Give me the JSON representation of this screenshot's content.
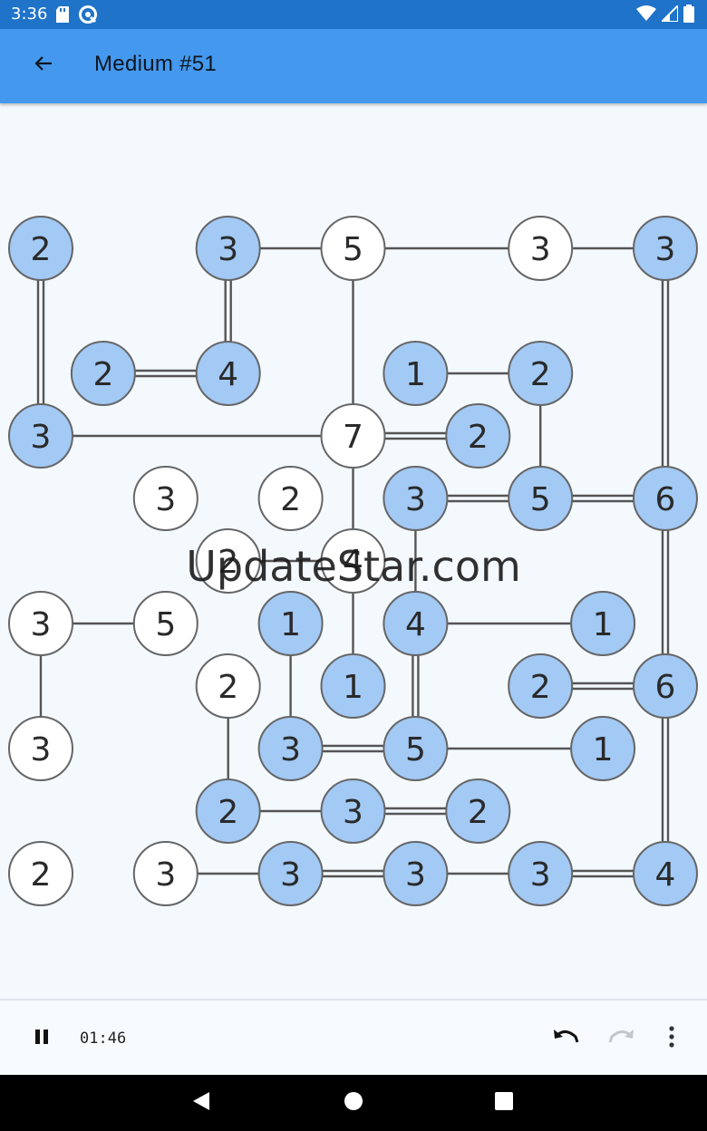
{
  "status_bar": {
    "time": "3:36",
    "icons": [
      "sd-card-icon",
      "sync-icon",
      "wifi-icon",
      "signal-icon",
      "battery-icon"
    ]
  },
  "app_bar": {
    "title": "Medium #51",
    "back_icon": "arrow-back-icon",
    "background": "#4499ee"
  },
  "puzzle": {
    "grid": {
      "cols": 11,
      "rows": 11
    },
    "colors": {
      "complete_fill": "#a3c9f5",
      "open_fill": "#ffffff",
      "node_stroke": "#666666",
      "bridge": "#555555"
    },
    "islands": [
      {
        "id": "a",
        "col": 0,
        "row": 0,
        "value": "2",
        "complete": true
      },
      {
        "id": "b",
        "col": 3,
        "row": 0,
        "value": "3",
        "complete": true
      },
      {
        "id": "c",
        "col": 5,
        "row": 0,
        "value": "5",
        "complete": false
      },
      {
        "id": "d",
        "col": 8,
        "row": 0,
        "value": "3",
        "complete": false
      },
      {
        "id": "e",
        "col": 10,
        "row": 0,
        "value": "3",
        "complete": true
      },
      {
        "id": "f",
        "col": 1,
        "row": 2,
        "value": "2",
        "complete": true
      },
      {
        "id": "g",
        "col": 3,
        "row": 2,
        "value": "4",
        "complete": true
      },
      {
        "id": "h",
        "col": 6,
        "row": 2,
        "value": "1",
        "complete": true
      },
      {
        "id": "i",
        "col": 8,
        "row": 2,
        "value": "2",
        "complete": true
      },
      {
        "id": "j",
        "col": 0,
        "row": 3,
        "value": "3",
        "complete": true
      },
      {
        "id": "k",
        "col": 5,
        "row": 3,
        "value": "7",
        "complete": false
      },
      {
        "id": "l",
        "col": 7,
        "row": 3,
        "value": "2",
        "complete": true
      },
      {
        "id": "m",
        "col": 2,
        "row": 4,
        "value": "3",
        "complete": false
      },
      {
        "id": "n",
        "col": 4,
        "row": 4,
        "value": "2",
        "complete": false
      },
      {
        "id": "o",
        "col": 6,
        "row": 4,
        "value": "3",
        "complete": true
      },
      {
        "id": "p",
        "col": 8,
        "row": 4,
        "value": "5",
        "complete": true
      },
      {
        "id": "q",
        "col": 10,
        "row": 4,
        "value": "6",
        "complete": true
      },
      {
        "id": "r",
        "col": 3,
        "row": 5,
        "value": "2",
        "complete": false
      },
      {
        "id": "s",
        "col": 5,
        "row": 5,
        "value": "4",
        "complete": false
      },
      {
        "id": "t",
        "col": 0,
        "row": 6,
        "value": "3",
        "complete": false
      },
      {
        "id": "u",
        "col": 2,
        "row": 6,
        "value": "5",
        "complete": false
      },
      {
        "id": "v",
        "col": 4,
        "row": 6,
        "value": "1",
        "complete": true
      },
      {
        "id": "w",
        "col": 6,
        "row": 6,
        "value": "4",
        "complete": true
      },
      {
        "id": "x",
        "col": 9,
        "row": 6,
        "value": "1",
        "complete": true
      },
      {
        "id": "y",
        "col": 3,
        "row": 7,
        "value": "2",
        "complete": false
      },
      {
        "id": "z",
        "col": 5,
        "row": 7,
        "value": "1",
        "complete": true
      },
      {
        "id": "aa",
        "col": 8,
        "row": 7,
        "value": "2",
        "complete": true
      },
      {
        "id": "ab",
        "col": 10,
        "row": 7,
        "value": "6",
        "complete": true
      },
      {
        "id": "ac",
        "col": 0,
        "row": 8,
        "value": "3",
        "complete": false
      },
      {
        "id": "ad",
        "col": 4,
        "row": 8,
        "value": "3",
        "complete": true
      },
      {
        "id": "ae",
        "col": 6,
        "row": 8,
        "value": "5",
        "complete": true
      },
      {
        "id": "af",
        "col": 9,
        "row": 8,
        "value": "1",
        "complete": true
      },
      {
        "id": "ag",
        "col": 3,
        "row": 9,
        "value": "2",
        "complete": true
      },
      {
        "id": "ah",
        "col": 5,
        "row": 9,
        "value": "3",
        "complete": true
      },
      {
        "id": "ai",
        "col": 7,
        "row": 9,
        "value": "2",
        "complete": true
      },
      {
        "id": "aj",
        "col": 0,
        "row": 10,
        "value": "2",
        "complete": false
      },
      {
        "id": "ak",
        "col": 2,
        "row": 10,
        "value": "3",
        "complete": false
      },
      {
        "id": "al",
        "col": 4,
        "row": 10,
        "value": "3",
        "complete": true
      },
      {
        "id": "am",
        "col": 6,
        "row": 10,
        "value": "3",
        "complete": true
      },
      {
        "id": "an",
        "col": 8,
        "row": 10,
        "value": "3",
        "complete": true
      },
      {
        "id": "ao",
        "col": 10,
        "row": 10,
        "value": "4",
        "complete": true
      }
    ],
    "bridges": [
      {
        "from": "b",
        "to": "c",
        "count": 1
      },
      {
        "from": "c",
        "to": "d",
        "count": 1
      },
      {
        "from": "d",
        "to": "e",
        "count": 1
      },
      {
        "from": "a",
        "to": "j",
        "count": 2
      },
      {
        "from": "b",
        "to": "g",
        "count": 2
      },
      {
        "from": "c",
        "to": "k",
        "count": 1
      },
      {
        "from": "e",
        "to": "q",
        "count": 2
      },
      {
        "from": "f",
        "to": "g",
        "count": 2
      },
      {
        "from": "h",
        "to": "i",
        "count": 1
      },
      {
        "from": "i",
        "to": "p",
        "count": 1
      },
      {
        "from": "j",
        "to": "k",
        "count": 1
      },
      {
        "from": "k",
        "to": "l",
        "count": 2
      },
      {
        "from": "k",
        "to": "s",
        "count": 1
      },
      {
        "from": "o",
        "to": "p",
        "count": 2
      },
      {
        "from": "p",
        "to": "q",
        "count": 2
      },
      {
        "from": "o",
        "to": "w",
        "count": 1
      },
      {
        "from": "q",
        "to": "ab",
        "count": 2
      },
      {
        "from": "r",
        "to": "s",
        "count": 1
      },
      {
        "from": "s",
        "to": "z",
        "count": 1
      },
      {
        "from": "t",
        "to": "u",
        "count": 1
      },
      {
        "from": "t",
        "to": "ac",
        "count": 1
      },
      {
        "from": "v",
        "to": "ad",
        "count": 1
      },
      {
        "from": "w",
        "to": "x",
        "count": 1
      },
      {
        "from": "w",
        "to": "ae",
        "count": 2
      },
      {
        "from": "aa",
        "to": "ab",
        "count": 2
      },
      {
        "from": "ab",
        "to": "ao",
        "count": 2
      },
      {
        "from": "y",
        "to": "ag",
        "count": 1
      },
      {
        "from": "ad",
        "to": "ae",
        "count": 2
      },
      {
        "from": "ae",
        "to": "af",
        "count": 1
      },
      {
        "from": "ag",
        "to": "ah",
        "count": 1
      },
      {
        "from": "ah",
        "to": "ai",
        "count": 2
      },
      {
        "from": "ak",
        "to": "al",
        "count": 1
      },
      {
        "from": "al",
        "to": "am",
        "count": 2
      },
      {
        "from": "am",
        "to": "an",
        "count": 1
      },
      {
        "from": "an",
        "to": "ao",
        "count": 2
      }
    ]
  },
  "watermark": "UpdateStar.com",
  "bottom_bar": {
    "timer": "01:46",
    "pause_icon": "pause-icon",
    "undo_icon": "undo-icon",
    "redo_icon": "redo-icon",
    "more_icon": "more-vert-icon"
  },
  "nav_bar": {
    "icons": [
      "nav-back-icon",
      "nav-home-icon",
      "nav-recents-icon"
    ]
  }
}
